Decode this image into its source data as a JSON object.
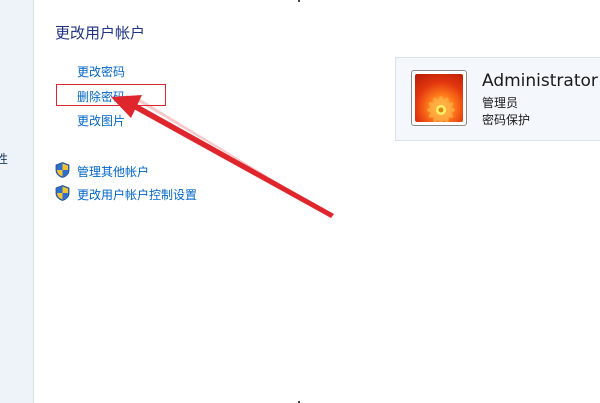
{
  "left_pane": {
    "partial_char": "性"
  },
  "main": {
    "title": "更改用户帐户",
    "tasks": [
      {
        "label": "更改密码"
      },
      {
        "label": "删除密码"
      },
      {
        "label": "更改图片"
      }
    ],
    "admin_tasks": [
      {
        "label": "管理其他帐户",
        "icon": "shield-icon"
      },
      {
        "label": "更改用户帐户控制设置",
        "icon": "shield-icon"
      }
    ]
  },
  "user": {
    "name": "Administrator",
    "role": "管理员",
    "status": "密码保护",
    "avatar_icon": "flower-avatar-icon"
  },
  "annotation": {
    "color": "#e0262d"
  }
}
